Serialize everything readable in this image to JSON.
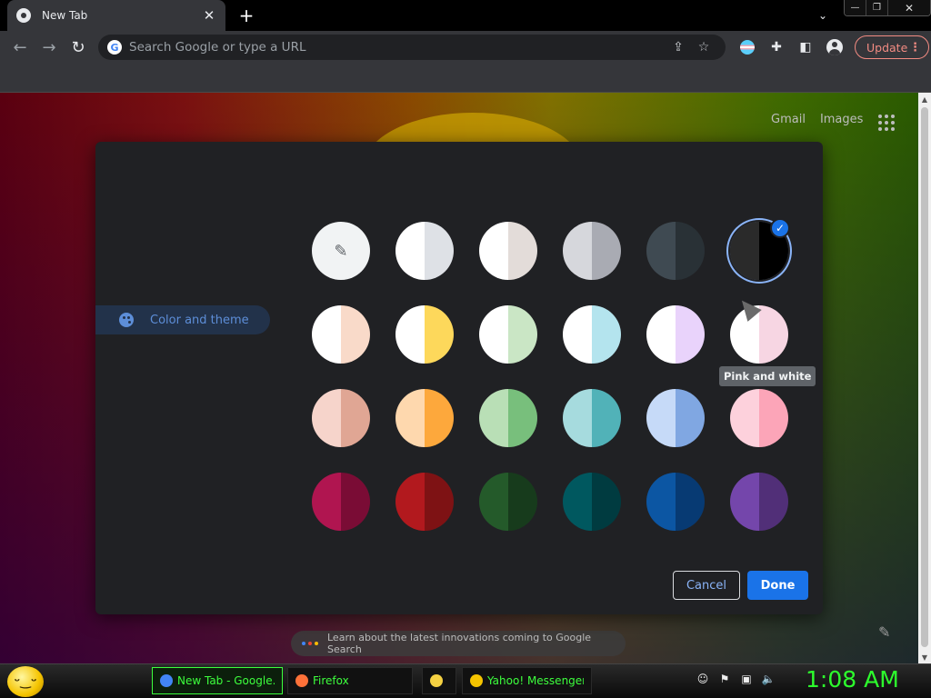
{
  "browser": {
    "tab_title": "New Tab",
    "tab_close": "✕",
    "new_tab": "+",
    "tab_search": "⌄",
    "window_controls": {
      "minimize": "—",
      "restore": "❐",
      "close": "✕"
    },
    "omnibox_placeholder": "Search Google or type a URL",
    "update_label": "Update",
    "update_menu": "⋮",
    "icons": {
      "back": "←",
      "forward": "→",
      "reload": "↻",
      "share": "⇪",
      "star": "☆",
      "extensions": "✚",
      "sidepanel": "◧"
    }
  },
  "ntp": {
    "gmail": "Gmail",
    "images": "Images",
    "learn_text": "Learn about the latest innovations coming to Google Search",
    "pencil": "✎"
  },
  "dialog": {
    "nav_item": "Color and theme",
    "tooltip": "Pink and white",
    "cancel": "Cancel",
    "done": "Done",
    "selected_index": 5,
    "swatches": [
      {
        "name": "eyedropper-swatch",
        "left": "#f1f3f4",
        "right": "#f1f3f4",
        "eyedropper": true
      },
      {
        "name": "swatch-grey-white",
        "left": "#ffffff",
        "right": "#dee1e6"
      },
      {
        "name": "swatch-warm-grey",
        "left": "#ffffff",
        "right": "#e3dcd9"
      },
      {
        "name": "swatch-cool-grey",
        "left": "#d6d7dc",
        "right": "#a9abb3"
      },
      {
        "name": "swatch-blue-grey",
        "left": "#3f4a52",
        "right": "#293136"
      },
      {
        "name": "swatch-black",
        "left": "#2a2a2a",
        "right": "#000000"
      },
      {
        "name": "swatch-beige-white",
        "left": "#ffffff",
        "right": "#f9dac9"
      },
      {
        "name": "swatch-yellow-white",
        "left": "#ffffff",
        "right": "#fdd85b"
      },
      {
        "name": "swatch-green-white",
        "left": "#ffffff",
        "right": "#cae6c5"
      },
      {
        "name": "swatch-light-teal-white",
        "left": "#ffffff",
        "right": "#b4e4ee"
      },
      {
        "name": "swatch-light-purple-white",
        "left": "#ffffff",
        "right": "#e9d3fb"
      },
      {
        "name": "swatch-pink-white",
        "left": "#ffffff",
        "right": "#f7d6e3"
      },
      {
        "name": "swatch-dark-beige",
        "left": "#f6d4cb",
        "right": "#e0a694"
      },
      {
        "name": "swatch-orange",
        "left": "#fed8ae",
        "right": "#fda83c"
      },
      {
        "name": "swatch-light-green",
        "left": "#b9dfb6",
        "right": "#78bf7c"
      },
      {
        "name": "swatch-light-teal",
        "left": "#a6dbde",
        "right": "#51b2b8"
      },
      {
        "name": "swatch-light-blue",
        "left": "#c6daf8",
        "right": "#80a7e2"
      },
      {
        "name": "swatch-light-pink",
        "left": "#fdd1dc",
        "right": "#fca5b8"
      },
      {
        "name": "swatch-dark-pink-red",
        "left": "#b01550",
        "right": "#7a0c35"
      },
      {
        "name": "swatch-dark-red-orange",
        "left": "#b2191e",
        "right": "#7e1214"
      },
      {
        "name": "swatch-dark-green",
        "left": "#245a2a",
        "right": "#173b1c"
      },
      {
        "name": "swatch-dark-teal",
        "left": "#00585f",
        "right": "#003b40"
      },
      {
        "name": "swatch-dark-blue",
        "left": "#0c56a3",
        "right": "#073a73"
      },
      {
        "name": "swatch-purple",
        "left": "#7446ab",
        "right": "#512f78"
      }
    ]
  },
  "taskbar": {
    "tasks": [
      {
        "label": "New Tab - Google...",
        "color": "#4285f4",
        "active": true
      },
      {
        "label": "Firefox",
        "color": "#ff7139",
        "active": false
      },
      {
        "label": "",
        "color": "#f5d142",
        "active": false
      },
      {
        "label": "Yahoo! Messenger",
        "color": "#f5c400",
        "active": false
      }
    ],
    "tray_icons": [
      "☺",
      "⚑",
      "▣",
      "🔈"
    ],
    "clock": "1:08 AM"
  }
}
